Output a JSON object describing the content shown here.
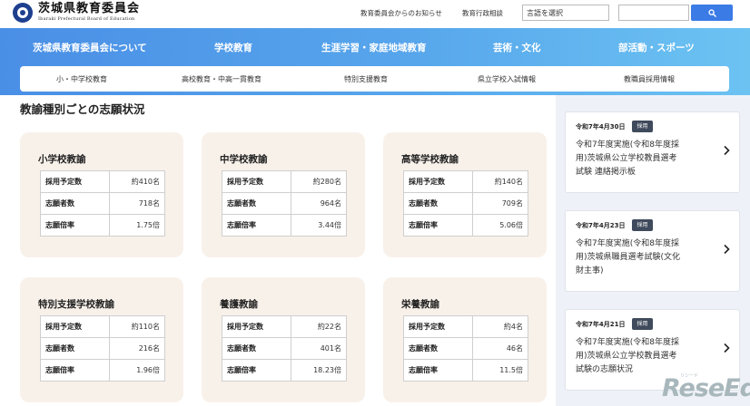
{
  "header": {
    "logo_title": "茨城県教育委員会",
    "logo_subtitle": "Ibaraki Prefectural Board of Education",
    "links": [
      "教育委員会からのお知らせ",
      "教育行政相談"
    ],
    "language_select": "言語を選択",
    "search_placeholder": "",
    "search_icon": "search-icon"
  },
  "nav": {
    "main": [
      "茨城県教育委員会について",
      "学校教育",
      "生涯学習・家庭地域教育",
      "芸術・文化",
      "部活動・スポーツ"
    ],
    "sub": [
      "小・中学校教育",
      "高校教育・中高一貫教育",
      "特別支援教育",
      "県立学校入試情報",
      "教職員採用情報"
    ]
  },
  "section_title": "教諭種別ごとの志願状況",
  "row_labels": {
    "planned": "採用予定数",
    "applicants": "志願者数",
    "ratio": "志願倍率"
  },
  "cards": [
    {
      "title": "小学校教諭",
      "planned": "約410名",
      "applicants": "718名",
      "ratio": "1.75倍"
    },
    {
      "title": "中学校教諭",
      "planned": "約280名",
      "applicants": "964名",
      "ratio": "3.44倍"
    },
    {
      "title": "高等学校教諭",
      "planned": "約140名",
      "applicants": "709名",
      "ratio": "5.06倍"
    },
    {
      "title": "特別支援学校教諭",
      "planned": "約110名",
      "applicants": "216名",
      "ratio": "1.96倍"
    },
    {
      "title": "養護教諭",
      "planned": "約22名",
      "applicants": "401名",
      "ratio": "18.23倍"
    },
    {
      "title": "栄養教諭",
      "planned": "約4名",
      "applicants": "46名",
      "ratio": "11.5倍"
    }
  ],
  "news": [
    {
      "date": "令和7年4月30日",
      "badge": "採用",
      "line1": "令和7年度実施(令和8年度採",
      "line2": "用)茨城県公立学校教員選考",
      "line3": "試験 連絡掲示板"
    },
    {
      "date": "令和7年4月23日",
      "badge": "採用",
      "line1": "令和7年度実施(令和8年度採",
      "line2": "用)茨城県職員選考試験(文化",
      "line3": "財主事)"
    },
    {
      "date": "令和7年4月21日",
      "badge": "採用",
      "line1": "令和7年度実施(令和8年度採",
      "line2": "用)茨城県公立学校教員選考",
      "line3": "試験の志願状況"
    }
  ],
  "watermark": {
    "text": "ReseEd",
    "small": "リシード"
  }
}
